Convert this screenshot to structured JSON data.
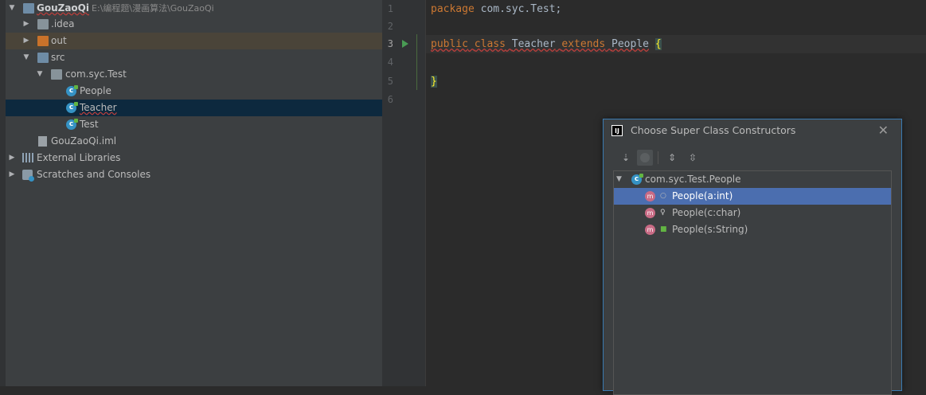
{
  "project_tree": {
    "root": {
      "name": "GouZaoQi",
      "path": "E:\\编程题\\漫画算法\\GouZaoQi"
    },
    "items": [
      {
        "label": ".idea"
      },
      {
        "label": "out"
      },
      {
        "label": "src"
      },
      {
        "label": "com.syc.Test"
      },
      {
        "label": "People"
      },
      {
        "label": "Teacher"
      },
      {
        "label": "Test"
      },
      {
        "label": "GouZaoQi.iml"
      },
      {
        "label": "External Libraries"
      },
      {
        "label": "Scratches and Consoles"
      }
    ]
  },
  "editor": {
    "line_numbers": [
      "1",
      "2",
      "3",
      "4",
      "5",
      "6"
    ],
    "current_line": 3,
    "line1": {
      "kw": "package",
      "rest": " com.syc.Test;"
    },
    "line3": {
      "kw1": "public",
      "kw2": "class",
      "name": "Teacher",
      "kw3": "extends",
      "parent": "People",
      "brace": "{"
    },
    "line5": {
      "brace": "}"
    }
  },
  "dialog": {
    "title": "Choose Super Class Constructors",
    "close_symbol": "✕",
    "tree": {
      "class": "com.syc.Test.People",
      "constructors": [
        {
          "label": "People(a:int)",
          "visibility": "package-private"
        },
        {
          "label": "People(c:char)",
          "visibility": "private"
        },
        {
          "label": "People(s:String)",
          "visibility": "public"
        }
      ]
    }
  },
  "colors": {
    "keyword": "#cc7832",
    "selection": "#4b6eaf",
    "project_selection": "#0d293e",
    "error_squiggle": "#bc3f3c"
  }
}
